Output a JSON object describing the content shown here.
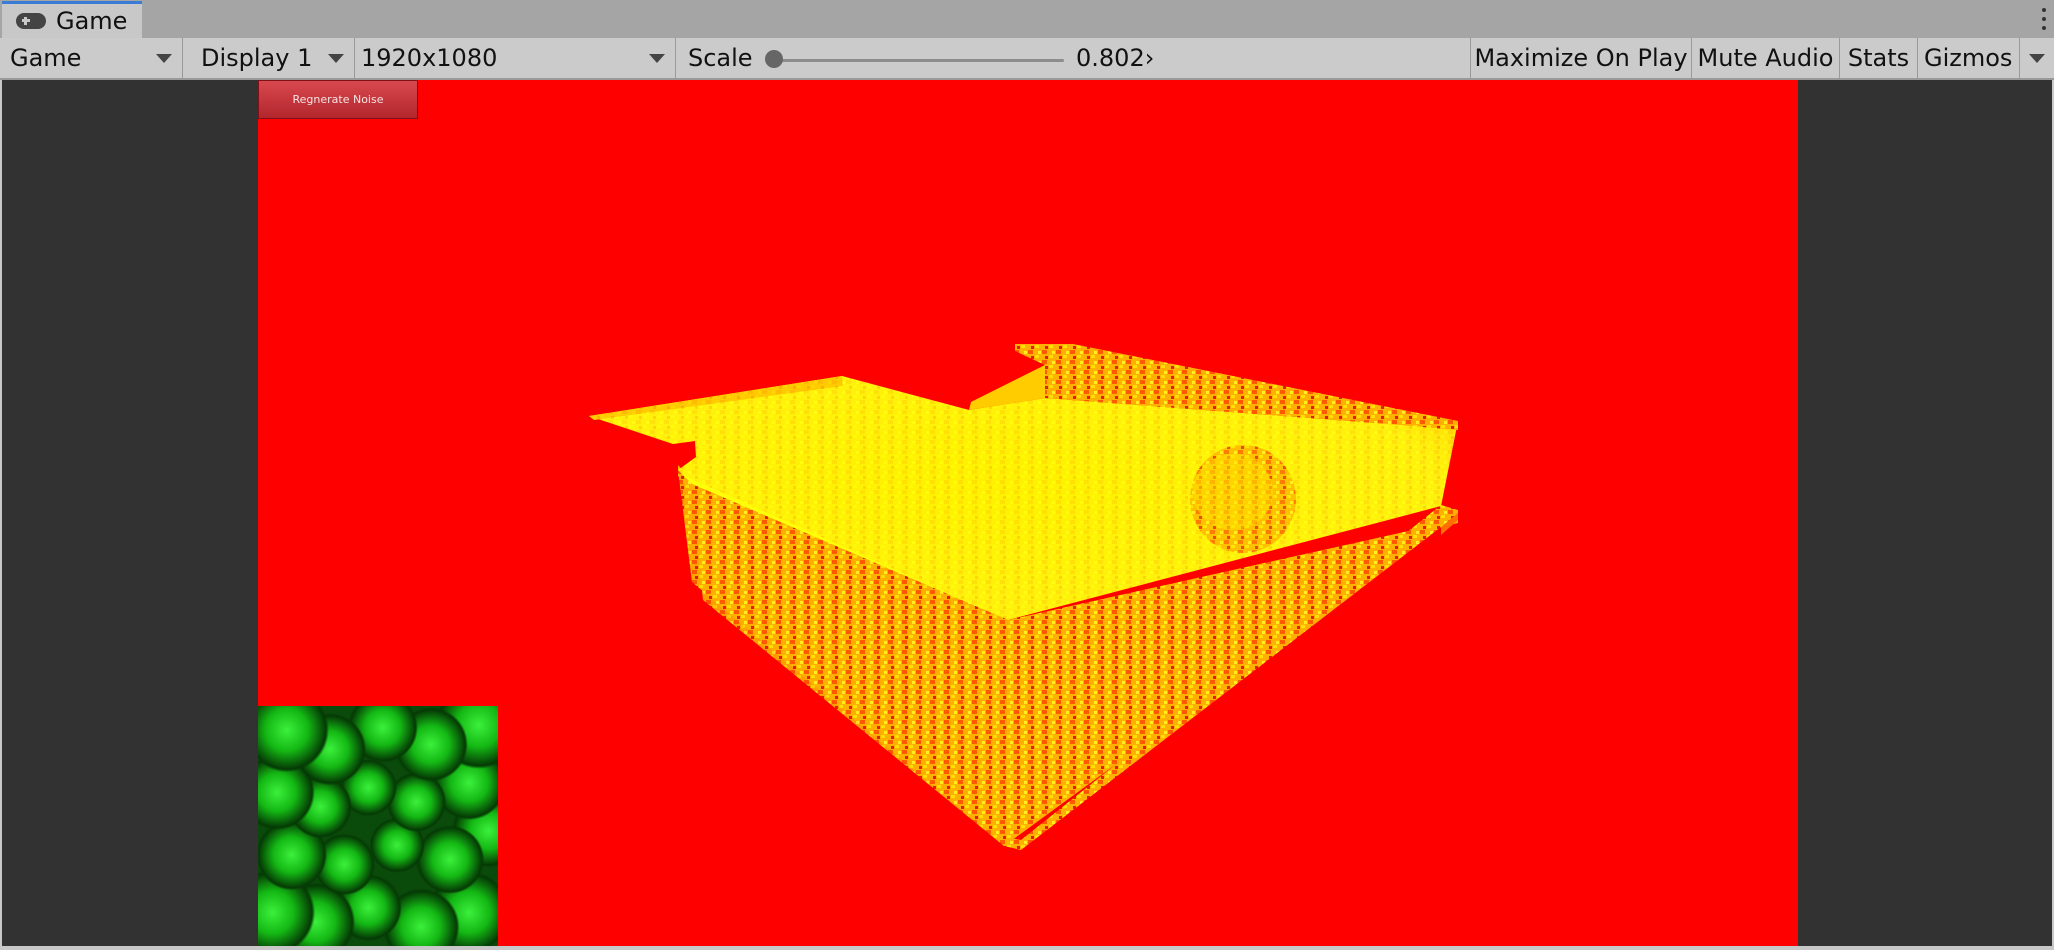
{
  "window": {
    "tab_label": "Game"
  },
  "toolbar": {
    "view_mode": "Game",
    "display": "Display 1",
    "resolution": "1920x1080",
    "scale_label": "Scale",
    "scale_value": "0.802›",
    "scale_fraction": 0.0,
    "maximize_on_play": "Maximize On Play",
    "mute_audio": "Mute Audio",
    "stats": "Stats",
    "gizmos": "Gizmos"
  },
  "game_view": {
    "background_color": "#ff0000",
    "letterbox_color": "#323232",
    "regenerate_button": "Regnerate Noise",
    "mesh_colors": [
      "#ffff00",
      "#ff8c00",
      "#ff3000"
    ],
    "noise_preview_color": "#1ccf1c"
  },
  "colors": {
    "tab_accent": "#3a7bd5",
    "toolbar_bg": "#cbcbcb",
    "tabbar_bg": "#a5a5a5"
  }
}
